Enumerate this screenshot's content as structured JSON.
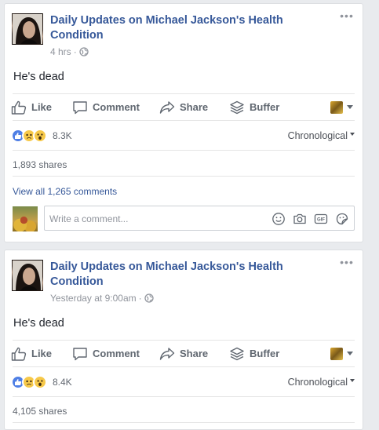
{
  "posts": [
    {
      "page_name": "Daily Updates on Michael Jackson's Health Condition",
      "time": "4 hrs",
      "dot": "·",
      "text": "He's dead",
      "actions": {
        "like": "Like",
        "comment": "Comment",
        "share": "Share",
        "buffer": "Buffer"
      },
      "reaction_count": "8.3K",
      "order": "Chronological",
      "shares": "1,893 shares",
      "view_comments": "View all 1,265 comments",
      "comment_placeholder": "Write a comment..."
    },
    {
      "page_name": "Daily Updates on Michael Jackson's Health Condition",
      "time": "Yesterday at 9:00am",
      "dot": "·",
      "text": "He's dead",
      "actions": {
        "like": "Like",
        "comment": "Comment",
        "share": "Share",
        "buffer": "Buffer"
      },
      "reaction_count": "8.4K",
      "order": "Chronological",
      "shares": "4,105 shares"
    }
  ],
  "icons": {
    "more": "more-horizontal-icon",
    "globe": "globe-icon",
    "reactions": [
      "like-reaction-icon",
      "sad-reaction-icon",
      "wow-reaction-icon"
    ],
    "comment_tools": [
      "emoji-icon",
      "camera-icon",
      "gif-icon",
      "sticker-icon"
    ]
  },
  "colors": {
    "link": "#365899",
    "background": "#e9ebee",
    "like_blue": "#4f7fe5",
    "emoji_yellow": "#f7c94a"
  }
}
